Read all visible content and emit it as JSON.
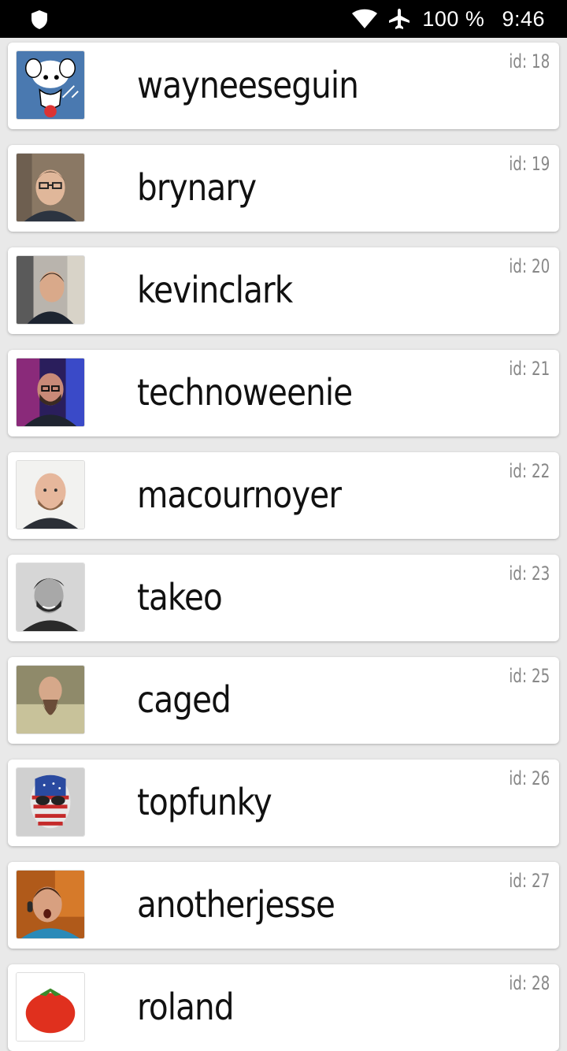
{
  "status_bar": {
    "battery": "100 %",
    "time": "9:46",
    "icons": [
      "shield-icon",
      "wifi-icon",
      "airplane-mode-icon"
    ]
  },
  "users": [
    {
      "login": "wayneeseguin",
      "id_label": "id: 18",
      "avatar_icon": "cartoon-mouse-avatar"
    },
    {
      "login": "brynary",
      "id_label": "id: 19",
      "avatar_icon": "person-glasses-avatar"
    },
    {
      "login": "kevinclark",
      "id_label": "id: 20",
      "avatar_icon": "person-avatar"
    },
    {
      "login": "technoweenie",
      "id_label": "id: 21",
      "avatar_icon": "person-avatar"
    },
    {
      "login": "macournoyer",
      "id_label": "id: 22",
      "avatar_icon": "person-avatar"
    },
    {
      "login": "takeo",
      "id_label": "id: 23",
      "avatar_icon": "person-avatar"
    },
    {
      "login": "caged",
      "id_label": "id: 25",
      "avatar_icon": "person-beard-avatar"
    },
    {
      "login": "topfunky",
      "id_label": "id: 26",
      "avatar_icon": "flag-face-avatar"
    },
    {
      "login": "anotherjesse",
      "id_label": "id: 27",
      "avatar_icon": "person-headphones-avatar"
    },
    {
      "login": "roland",
      "id_label": "id: 28",
      "avatar_icon": "tomato-avatar"
    }
  ],
  "colors": {
    "background": "#e9e9e9",
    "card": "#ffffff",
    "id_text": "#888888",
    "name_text": "#111111"
  }
}
